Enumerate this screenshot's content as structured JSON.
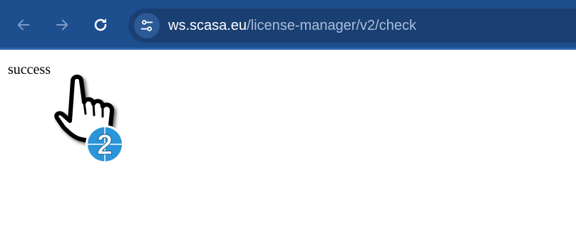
{
  "browser": {
    "back_icon": "arrow-left-icon",
    "forward_icon": "arrow-right-icon",
    "reload_icon": "reload-icon",
    "site_info_icon": "tune-icon",
    "url_host": "ws.scasa.eu",
    "url_path": "/license-manager/v2/check"
  },
  "page": {
    "text": "success"
  },
  "overlay": {
    "cursor_icon": "hand-pointer-icon",
    "step_badge": "2"
  },
  "colors": {
    "toolbar": "#1d4e8e",
    "omnibox": "#1a3f72",
    "badge": "#2a95d8"
  }
}
